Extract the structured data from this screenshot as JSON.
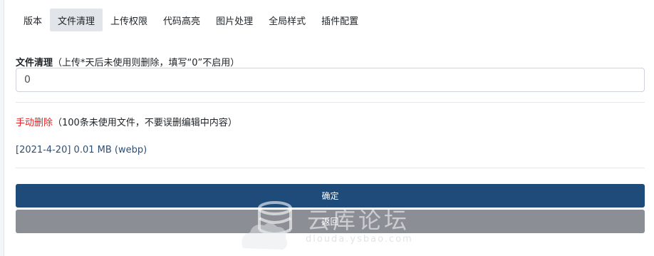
{
  "tabs": [
    {
      "label": "版本",
      "active": false
    },
    {
      "label": "文件清理",
      "active": true
    },
    {
      "label": "上传权限",
      "active": false
    },
    {
      "label": "代码高亮",
      "active": false
    },
    {
      "label": "图片处理",
      "active": false
    },
    {
      "label": "全局样式",
      "active": false
    },
    {
      "label": "插件配置",
      "active": false
    }
  ],
  "file_cleanup": {
    "label": "文件清理",
    "hint": "（上传*天后未使用则删除，填写“0”不启用）",
    "value": "0"
  },
  "manual_delete": {
    "link_label": "手动删除",
    "note": "（100条未使用文件，不要误删编辑中内容）"
  },
  "files": [
    {
      "text": "[2021-4-20] 0.01 MB (webp)"
    }
  ],
  "buttons": {
    "confirm": "确定",
    "back": "返回"
  },
  "watermark": {
    "title": "云库论坛",
    "subtitle": "dlouda.ysbao.com"
  },
  "colors": {
    "accent": "#1f4b7a",
    "secondary": "#8b8f95",
    "danger": "#e02424",
    "link": "#2d4e74",
    "active_tab_bg": "#e1e4e8"
  }
}
